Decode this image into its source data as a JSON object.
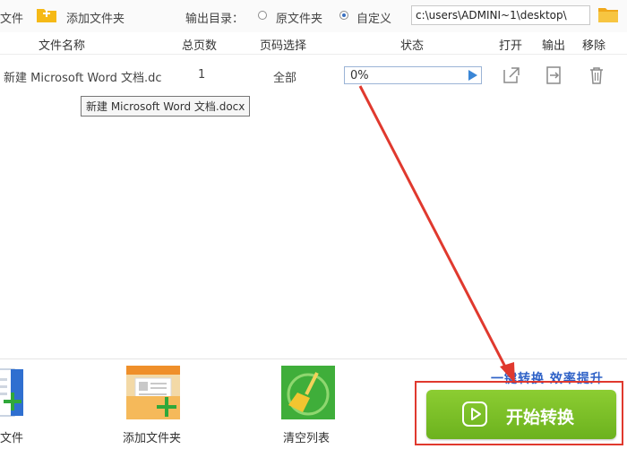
{
  "toolbar": {
    "add_file_label": "文件",
    "add_folder_label": "添加文件夹",
    "output_dir_label": "输出目录：",
    "option_original": "原文件夹",
    "option_custom": "自定义",
    "selected_option": "自定义",
    "output_path": "c:\\users\\ADMINI~1\\desktop\\"
  },
  "table": {
    "headers": [
      "文件名称",
      "总页数",
      "页码选择",
      "状态",
      "打开",
      "输出",
      "移除"
    ],
    "rows": [
      {
        "filename": "新建 Microsoft Word 文档.dc",
        "pages": "1",
        "page_selection": "全部",
        "progress_text": "0%",
        "progress": 0
      }
    ],
    "tooltip": "新建 Microsoft Word 文档.docx"
  },
  "bottom": {
    "add_file_label": "文件",
    "add_folder_label": "添加文件夹",
    "clear_list_label": "清空列表",
    "promo_text": "一键转换  效率提升",
    "start_button_label": "开始转换"
  },
  "colors": {
    "accent_green": "#7cc22a",
    "highlight_red": "#e0392e",
    "promo_blue": "#2f62c7",
    "folder_yellow": "#f5b916"
  }
}
